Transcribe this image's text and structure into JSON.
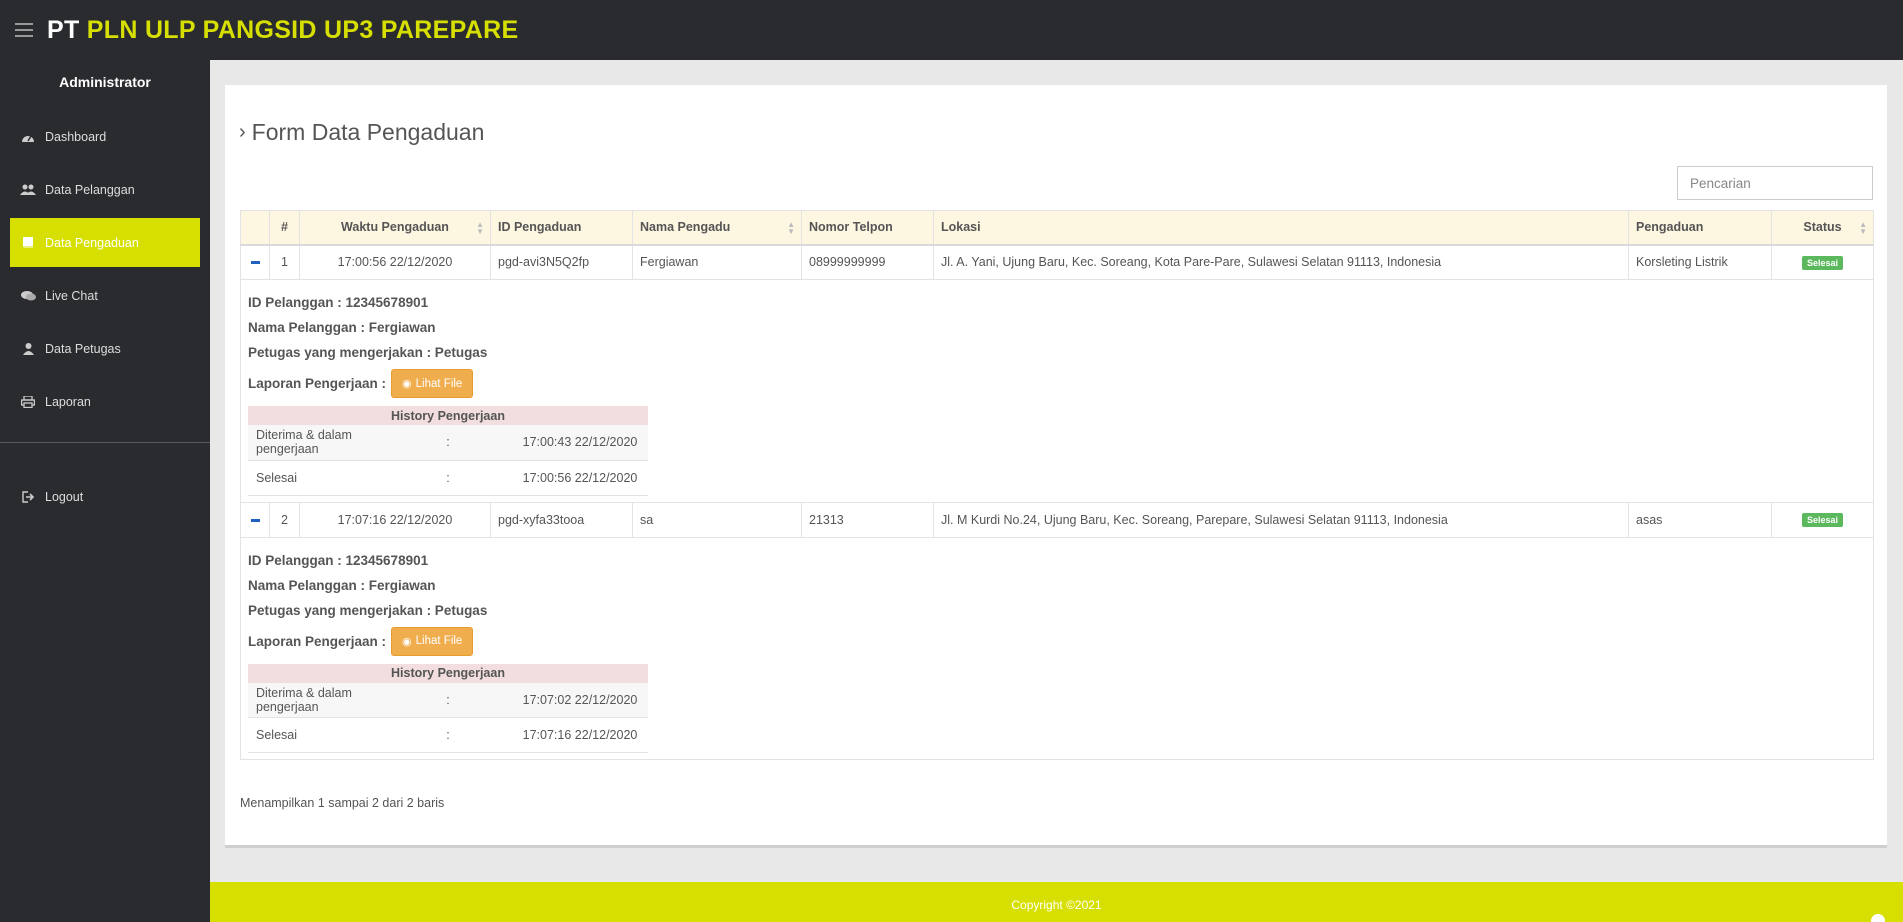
{
  "brand": {
    "pt": "PT",
    "rest": "PLN ULP PANGSID UP3 PAREPARE"
  },
  "sidebar": {
    "title": "Administrator",
    "items": [
      {
        "label": "Dashboard",
        "icon": "dashboard-icon"
      },
      {
        "label": "Data Pelanggan",
        "icon": "users-icon"
      },
      {
        "label": "Data Pengaduan",
        "icon": "book-icon",
        "active": true
      },
      {
        "label": "Live Chat",
        "icon": "comments-icon"
      },
      {
        "label": "Data Petugas",
        "icon": "user-icon"
      },
      {
        "label": "Laporan",
        "icon": "print-icon"
      }
    ],
    "logout": "Logout"
  },
  "page": {
    "title": "Form Data Pengaduan"
  },
  "search": {
    "placeholder": "Pencarian"
  },
  "table": {
    "headers": [
      "#",
      "Waktu Pengaduan",
      "ID Pengaduan",
      "Nama Pengadu",
      "Nomor Telpon",
      "Lokasi",
      "Pengaduan",
      "Status"
    ],
    "rows": [
      {
        "no": "1",
        "waktu": "17:00:56 22/12/2020",
        "id": "pgd-avi3N5Q2fp",
        "nama": "Fergiawan",
        "telpon": "08999999999",
        "lokasi": "Jl. A. Yani, Ujung Baru, Kec. Soreang, Kota Pare-Pare, Sulawesi Selatan 91113, Indonesia",
        "pengaduan": "Korsleting Listrik",
        "status": "Selesai",
        "detail": {
          "id_pelanggan": "ID Pelanggan : 12345678901",
          "nama_pelanggan": "Nama Pelanggan : Fergiawan",
          "petugas": "Petugas yang mengerjakan : Petugas",
          "laporan_label": "Laporan Pengerjaan :",
          "button": "Lihat File",
          "history_title": "History Pengerjaan",
          "history": [
            {
              "label": "Diterima & dalam pengerjaan",
              "sep": ":",
              "time": "17:00:43 22/12/2020"
            },
            {
              "label": "Selesai",
              "sep": ":",
              "time": "17:00:56 22/12/2020"
            }
          ]
        }
      },
      {
        "no": "2",
        "waktu": "17:07:16 22/12/2020",
        "id": "pgd-xyfa33tooa",
        "nama": "sa",
        "telpon": "21313",
        "lokasi": "Jl. M Kurdi No.24, Ujung Baru, Kec. Soreang, Parepare, Sulawesi Selatan 91113, Indonesia",
        "pengaduan": "asas",
        "status": "Selesai",
        "detail": {
          "id_pelanggan": "ID Pelanggan : 12345678901",
          "nama_pelanggan": "Nama Pelanggan : Fergiawan",
          "petugas": "Petugas yang mengerjakan : Petugas",
          "laporan_label": "Laporan Pengerjaan :",
          "button": "Lihat File",
          "history_title": "History Pengerjaan",
          "history": [
            {
              "label": "Diterima & dalam pengerjaan",
              "sep": ":",
              "time": "17:07:02 22/12/2020"
            },
            {
              "label": "Selesai",
              "sep": ":",
              "time": "17:07:16 22/12/2020"
            }
          ]
        }
      }
    ]
  },
  "info": "Menampilkan 1 sampai 2 dari 2 baris",
  "footer": "Copyright ©2021",
  "colors": {
    "accent": "#d7df01",
    "dark": "#2a2b2f",
    "success": "#5cb85c",
    "warning": "#f0ad4e"
  }
}
